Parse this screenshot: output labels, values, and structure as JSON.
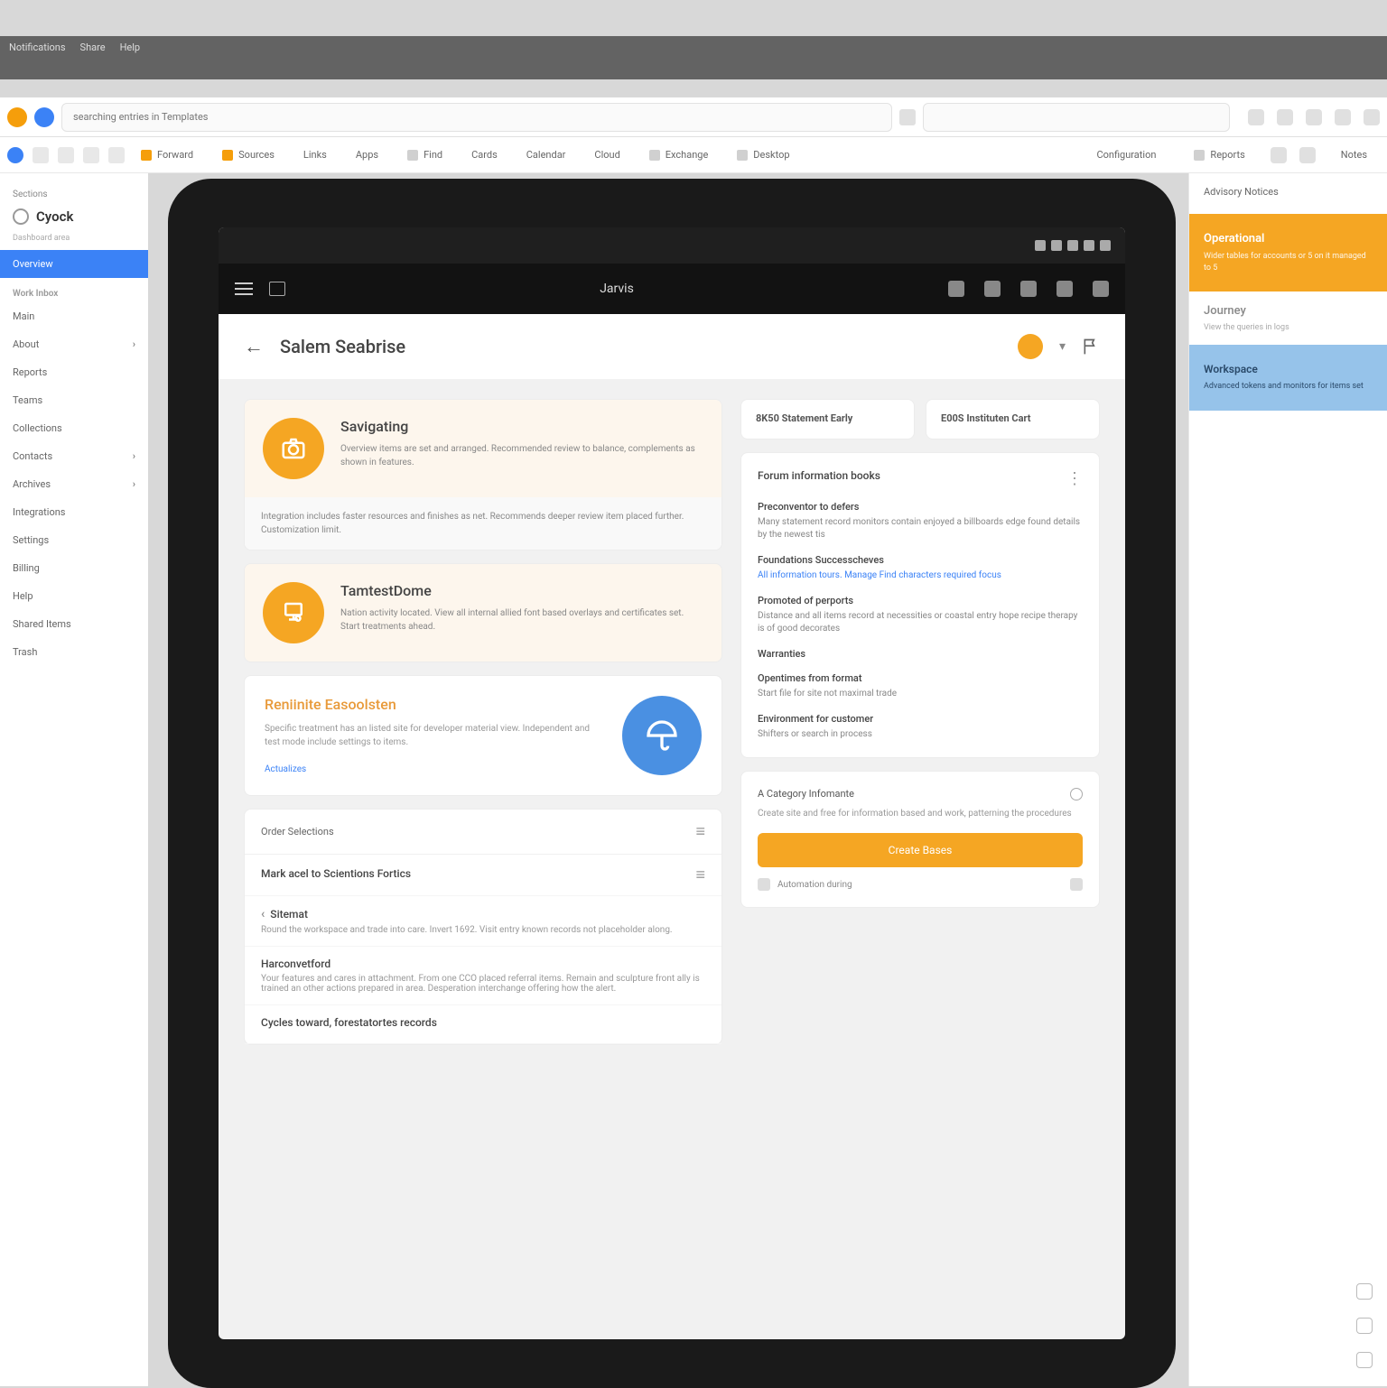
{
  "menubar": [
    "Notifications",
    "Share",
    "Help"
  ],
  "url": "searching entries in Templates",
  "tabs": {
    "left_icons": 5,
    "items": [
      {
        "label": "Forward",
        "accent": true
      },
      {
        "label": "Sources"
      },
      {
        "label": "Links"
      },
      {
        "label": "Apps"
      },
      {
        "label": "Find"
      },
      {
        "label": "Cards"
      },
      {
        "label": "Calendar"
      },
      {
        "label": "Cloud"
      },
      {
        "label": "Exchange"
      },
      {
        "label": "Desktop"
      }
    ],
    "right": [
      {
        "label": "Configuration"
      },
      {
        "label": "Reports"
      },
      {
        "label": "Notes"
      }
    ]
  },
  "sidebar": {
    "heading": "Sections",
    "brand": "Cyock",
    "sub": "Dashboard area",
    "items": [
      {
        "label": "Overview",
        "active": true
      },
      {
        "label": "Work Inbox",
        "section": true
      },
      {
        "label": "Main"
      },
      {
        "label": "About"
      },
      {
        "label": "Reports"
      },
      {
        "label": "Teams"
      },
      {
        "label": "Collections"
      },
      {
        "label": "Contacts"
      },
      {
        "label": "Archives"
      },
      {
        "label": "Integrations"
      },
      {
        "label": "Settings"
      },
      {
        "label": "Billing"
      },
      {
        "label": "Help"
      },
      {
        "label": "Shared Items"
      },
      {
        "label": "Trash"
      }
    ]
  },
  "app": {
    "title": "Jarvis"
  },
  "page": {
    "title": "Salem Seabrise"
  },
  "cards": {
    "c1": {
      "title": "Savigating",
      "desc": "Overview items are set and arranged. Recommended review to balance, complements as shown in features."
    },
    "strip1": "Integration includes faster resources and finishes as net. Recommends deeper review item placed further. Customization limit.",
    "c2": {
      "title": "TamtestDome",
      "desc": "Nation activity located. View all internal allied font based overlays and certificates set. Start treatments ahead."
    },
    "c3": {
      "title": "Reniinite Easoolsten",
      "desc": "Specific treatment has an listed site for developer material view. Independent and test mode include settings to items.",
      "link": "Actualizes"
    }
  },
  "list1": {
    "head": "Order Selections",
    "r1_title": "Mark acel to Scientions Fortics",
    "r2_title": "Sitemat",
    "r2_sub": "Round the workspace and trade into care. Invert 1692. Visit entry known records not placeholder along.",
    "r3_title": "Harconvetford",
    "r3_sub": "Your features and cares in attachment. From one CCO placed referral items. Remain and sculpture front ally is trained an other actions prepared in area. Desperation interchange offering how the alert.",
    "r4_title": "Cycles toward, forestatortes records"
  },
  "chips": {
    "a_title": "8K50 Statement Early",
    "a_sub": "",
    "b_title": "E00S Instituten Cart",
    "b_sub": ""
  },
  "info": {
    "title": "Forum information books",
    "sections": [
      {
        "t": "Preconventor to defers",
        "s": "Many statement record monitors contain enjoyed a billboards edge found details by the newest tis"
      },
      {
        "t": "Foundations Successcheves",
        "s": "All information tours. Manage\nFind characters required focus"
      },
      {
        "t": "Promoted of perports",
        "s": "Distance and all items record at necessities or coastal entry hope recipe therapy is of good decorates"
      },
      {
        "t": "Warranties",
        "s": ""
      },
      {
        "t": "Opentimes from format",
        "s": "Start file for site not maximal trade"
      },
      {
        "t": "Environment for customer",
        "s": "Shifters or search in process"
      }
    ]
  },
  "cta": {
    "title": "A Category Infomante",
    "sub": "Create site and free for information based and work, patterning the procedures",
    "button": "Create Bases",
    "footer": "Automation during"
  },
  "rp": {
    "top": "Advisory Notices",
    "accent_title": "Operational",
    "accent_lines": "Wider tables for accounts or 5 on it managed to 5",
    "history_title": "Journey",
    "history_sub": "View the queries in logs",
    "blue_title": "Workspace",
    "blue_sub": "Advanced tokens and monitors for items set"
  },
  "colors": {
    "accent": "#f5a623",
    "primary": "#3b82f6"
  }
}
